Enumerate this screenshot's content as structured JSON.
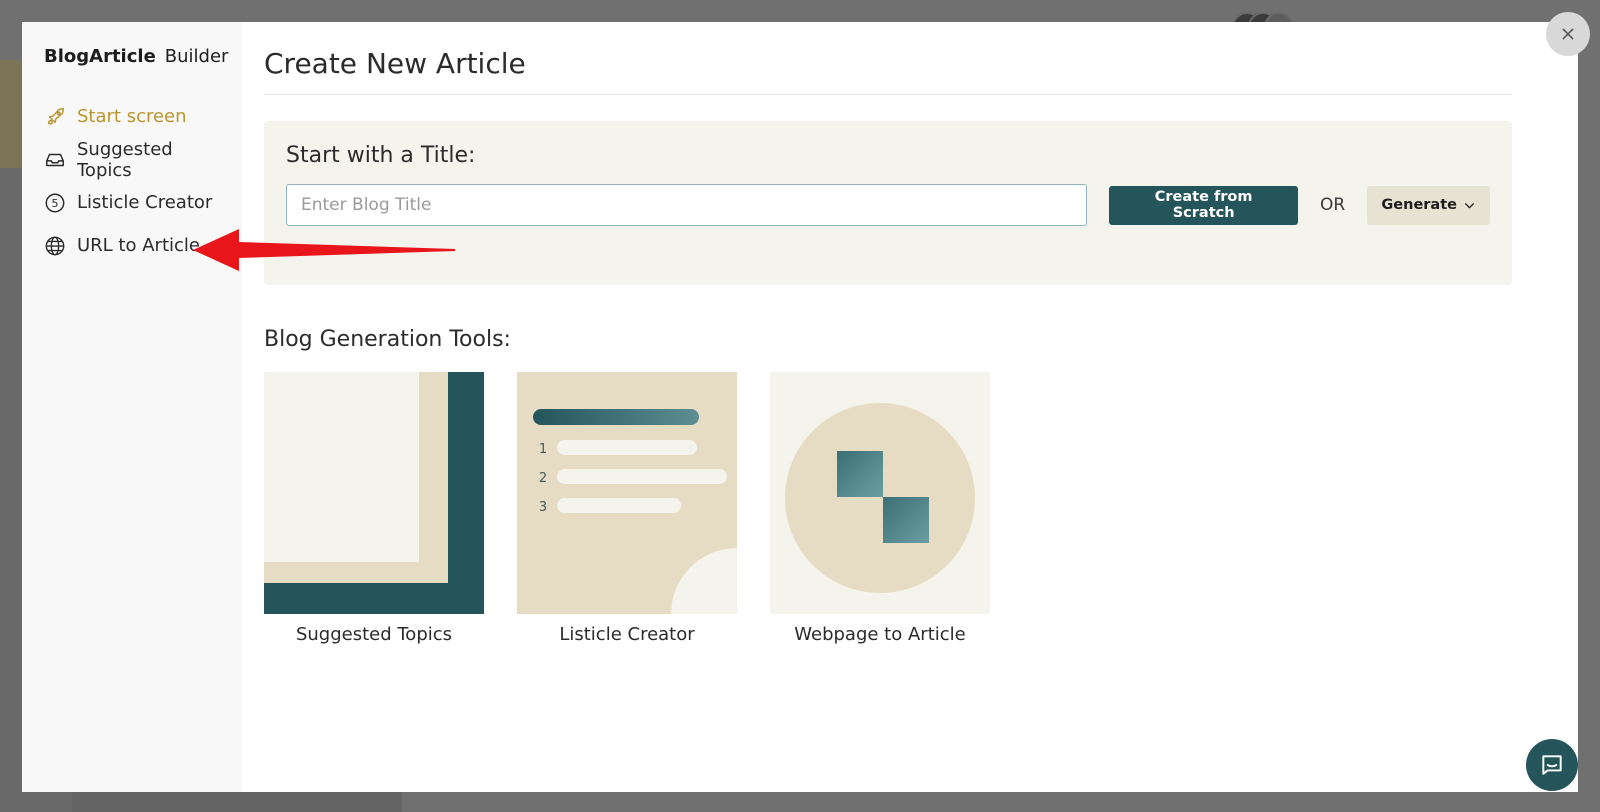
{
  "brand": {
    "name_bold": "BlogArticle",
    "name_regular": "Builder"
  },
  "sidebar": {
    "items": [
      {
        "label": "Start screen",
        "icon": "rocket-icon",
        "active": true
      },
      {
        "label": "Suggested Topics",
        "icon": "tray-icon",
        "active": false
      },
      {
        "label": "Listicle Creator",
        "icon": "number-five-circle-icon",
        "active": false
      },
      {
        "label": "URL to Article",
        "icon": "globe-icon",
        "active": false
      }
    ]
  },
  "main": {
    "title": "Create New Article",
    "start": {
      "label": "Start with a Title:",
      "input_placeholder": "Enter Blog Title",
      "input_value": "",
      "create_button": "Create from Scratch",
      "or_text": "OR",
      "generate_button": "Generate"
    },
    "tools": {
      "label": "Blog Generation Tools:",
      "cards": [
        {
          "label": "Suggested Topics"
        },
        {
          "label": "Listicle Creator",
          "list_numbers": [
            "1",
            "2",
            "3"
          ]
        },
        {
          "label": "Webpage to Article"
        }
      ]
    }
  },
  "colors": {
    "accent_teal": "#24555b",
    "active_gold": "#b8962e",
    "beige": "#e5dcc3",
    "cream": "#f4f3ec",
    "annotation_red": "#e8161a"
  }
}
